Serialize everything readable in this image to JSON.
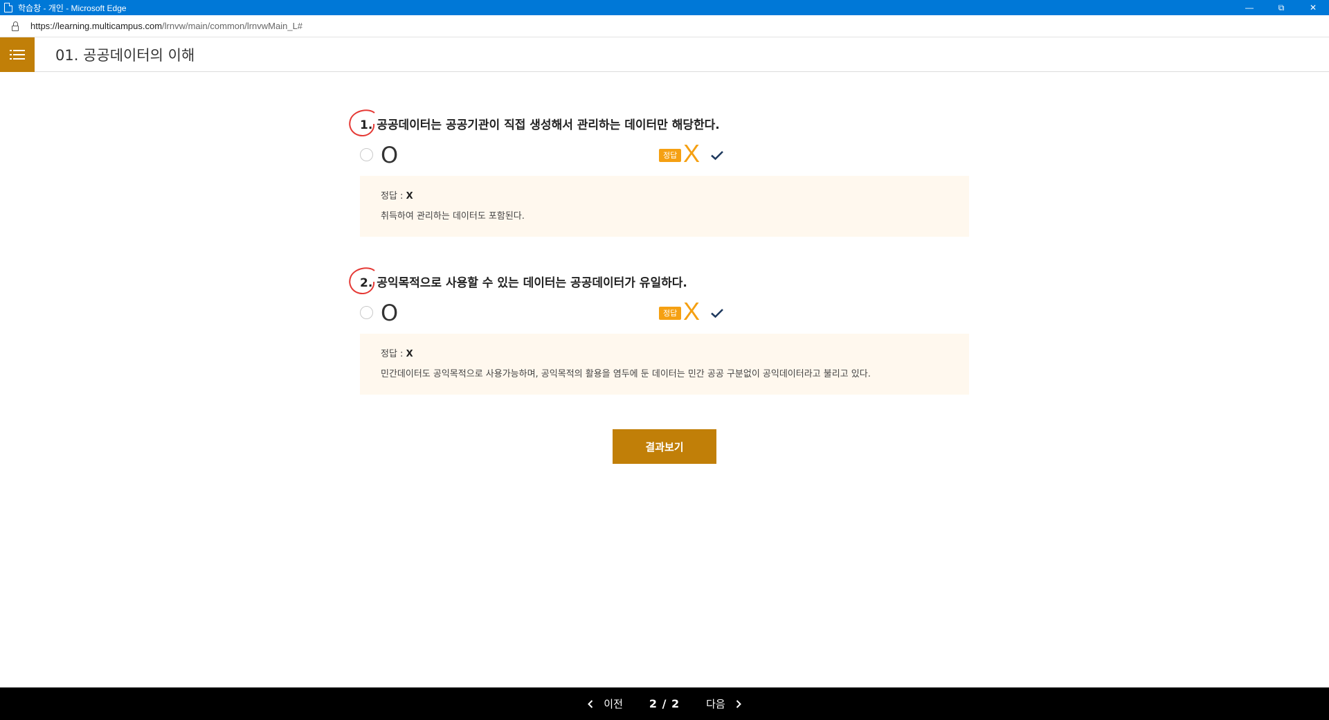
{
  "window": {
    "title": "학습창 - 개인 - Microsoft Edge",
    "minimize": "—",
    "restore": "⧉",
    "close": "✕"
  },
  "address": {
    "host": "https://learning.multicampus.com",
    "path": "/lrnvw/main/common/lrnvwMain_L#"
  },
  "header": {
    "title": "01. 공공데이터의 이해"
  },
  "questions": [
    {
      "number": "1.",
      "text": " 공공데이터는 공공기관이 직접 생성해서 관리하는 데이터만 해당한다.",
      "option": "O",
      "badge": "정답",
      "correct_mark": "X",
      "answer_label": "정답 : ",
      "answer_value": "X",
      "explanation": "취득하여 관리하는 데이터도 포함된다."
    },
    {
      "number": "2.",
      "text": " 공익목적으로 사용할 수 있는 데이터는 공공데이터가 유일하다.",
      "option": "O",
      "badge": "정답",
      "correct_mark": "X",
      "answer_label": "정답 : ",
      "answer_value": "X",
      "explanation": "민간데이터도 공익목적으로 사용가능하며, 공익목적의 활용을 염두에 둔 데이터는 민간 공공 구분없이 공익데이터라고 불리고 있다."
    }
  ],
  "result_button": "결과보기",
  "footer": {
    "prev": "이전",
    "page": "2 / 2",
    "next": "다음"
  },
  "colors": {
    "accent": "#c17f08",
    "badge": "#f5a012",
    "explain_bg": "#fff8ee",
    "check": "#1f3a5f",
    "circle_mark": "#e53935"
  }
}
